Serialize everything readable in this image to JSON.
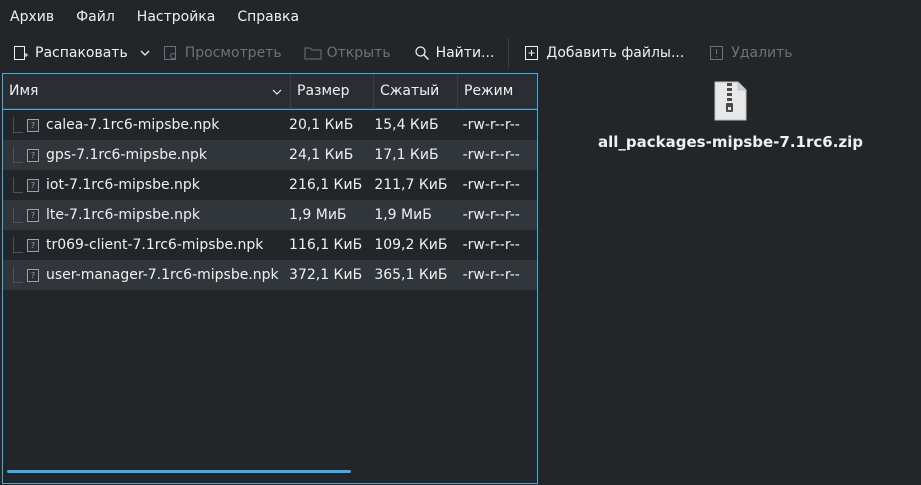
{
  "menu": [
    "Архив",
    "Файл",
    "Настройка",
    "Справка"
  ],
  "toolbar": {
    "extract": "Распаковать",
    "preview": "Просмотреть",
    "open": "Открыть",
    "find": "Найти...",
    "add_files": "Добавить файлы...",
    "delete": "Удалить"
  },
  "table": {
    "headers": {
      "name": "Имя",
      "size": "Размер",
      "compressed": "Сжатый",
      "mode": "Режим"
    },
    "rows": [
      {
        "name": "calea-7.1rc6-mipsbe.npk",
        "size": "20,1 КиБ",
        "compressed": "15,4 КиБ",
        "mode": "-rw-r--r--"
      },
      {
        "name": "gps-7.1rc6-mipsbe.npk",
        "size": "24,1 КиБ",
        "compressed": "17,1 КиБ",
        "mode": "-rw-r--r--"
      },
      {
        "name": "iot-7.1rc6-mipsbe.npk",
        "size": "216,1 КиБ",
        "compressed": "211,7 КиБ",
        "mode": "-rw-r--r--"
      },
      {
        "name": "lte-7.1rc6-mipsbe.npk",
        "size": "1,9 МиБ",
        "compressed": "1,9 МиБ",
        "mode": "-rw-r--r--"
      },
      {
        "name": "tr069-client-7.1rc6-mipsbe.npk",
        "size": "116,1 КиБ",
        "compressed": "109,2 КиБ",
        "mode": "-rw-r--r--"
      },
      {
        "name": "user-manager-7.1rc6-mipsbe.npk",
        "size": "372,1 КиБ",
        "compressed": "365,1 КиБ",
        "mode": "-rw-r--r--"
      }
    ]
  },
  "archive": {
    "filename": "all_packages-mipsbe-7.1rc6.zip"
  },
  "colors": {
    "accent": "#3daee9",
    "background": "#232629",
    "text": "#eff0f1",
    "disabled": "#6e7175"
  }
}
